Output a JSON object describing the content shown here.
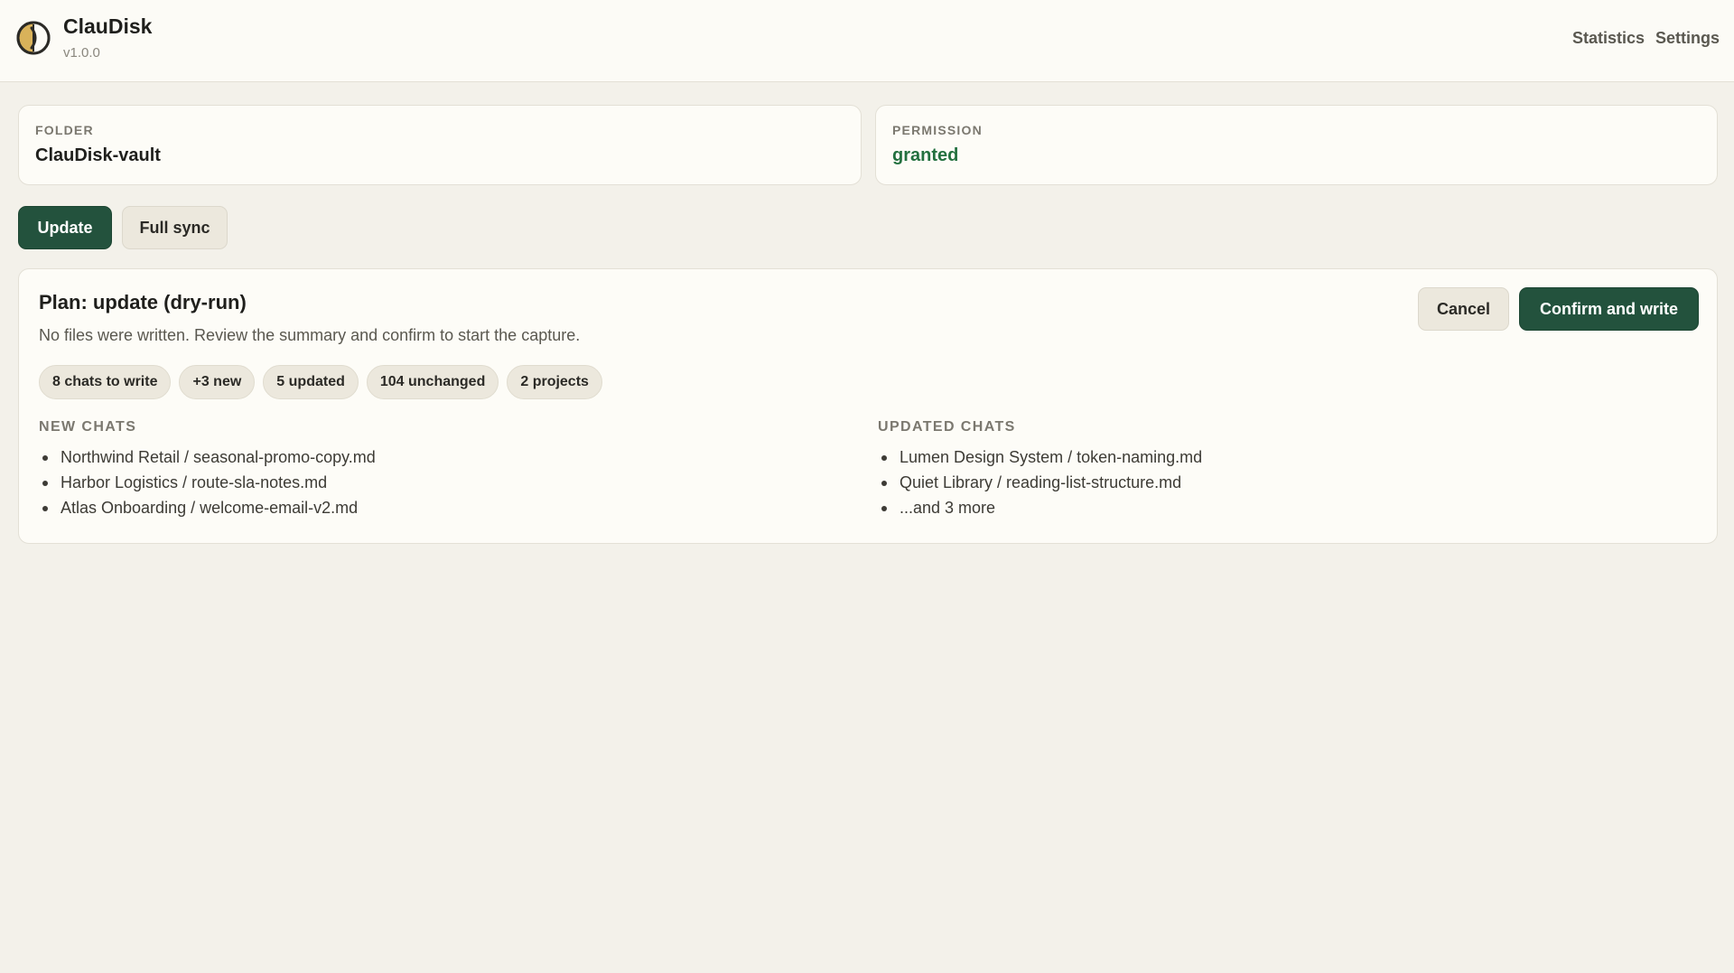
{
  "app": {
    "name": "ClauDisk",
    "version": "v1.0.0",
    "logo_icon": "claudisk-logo-icon",
    "nav": [
      "Statistics",
      "Settings"
    ]
  },
  "folder": {
    "label": "FOLDER",
    "value": "ClauDisk-vault"
  },
  "permission": {
    "label": "PERMISSION",
    "value": "granted",
    "value_color": "#23703f"
  },
  "actions": {
    "update": "Update",
    "full_sync": "Full sync"
  },
  "plan": {
    "title": "Plan: update (dry-run)",
    "description": "No files were written. Review the summary and confirm to start the capture.",
    "cancel": "Cancel",
    "confirm": "Confirm and write",
    "chips": [
      "8 chats to write",
      "+3 new",
      "5 updated",
      "104 unchanged",
      "2 projects"
    ],
    "new_chats": {
      "heading": "NEW CHATS",
      "items": [
        "Northwind Retail / seasonal-promo-copy.md",
        "Harbor Logistics / route-sla-notes.md",
        "Atlas Onboarding / welcome-email-v2.md"
      ]
    },
    "updated_chats": {
      "heading": "UPDATED CHATS",
      "items": [
        "Lumen Design System / token-naming.md",
        "Quiet Library / reading-list-structure.md",
        "...and 3 more"
      ]
    }
  },
  "colors": {
    "accent": "#23523d",
    "background": "#f3f1ea",
    "card": "#fdfcf7"
  }
}
